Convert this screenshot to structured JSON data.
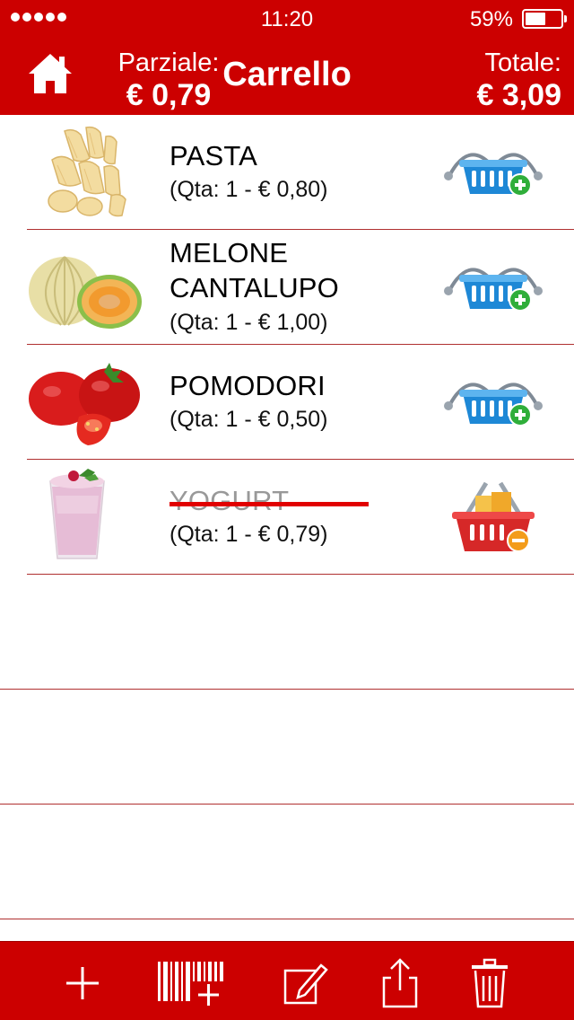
{
  "status_bar": {
    "time": "11:20",
    "battery_percent": "59%",
    "battery_level": 0.59
  },
  "header": {
    "title": "Carrello",
    "partial_label": "Parziale:",
    "partial_value": "€ 0,79",
    "total_label": "Totale:",
    "total_value": "€ 3,09"
  },
  "items": [
    {
      "name": "PASTA",
      "detail": "(Qta: 1  - € 0,80)",
      "in_cart": false,
      "image": "pasta-image",
      "action_icon": "basket-add-icon"
    },
    {
      "name": "MELONE CANTALUPO",
      "detail": "(Qta: 1  - € 1,00)",
      "in_cart": false,
      "image": "cantaloupe-melon-image",
      "action_icon": "basket-add-icon"
    },
    {
      "name": "POMODORI",
      "detail": "(Qta: 1  - € 0,50)",
      "in_cart": false,
      "image": "tomatoes-image",
      "action_icon": "basket-add-icon"
    },
    {
      "name": "YOGURT",
      "detail": "(Qta: 1  - € 0,79)",
      "in_cart": true,
      "image": "yogurt-image",
      "action_icon": "basket-remove-icon"
    }
  ],
  "toolbar": {
    "buttons": [
      "plus-icon",
      "barcode-add-icon",
      "edit-icon",
      "share-icon",
      "trash-icon"
    ]
  },
  "colors": {
    "brand_red": "#cc0000",
    "separator": "#b03030",
    "strike": "#e10000",
    "add_basket": "#1e88d6",
    "remove_basket": "#d62828"
  }
}
